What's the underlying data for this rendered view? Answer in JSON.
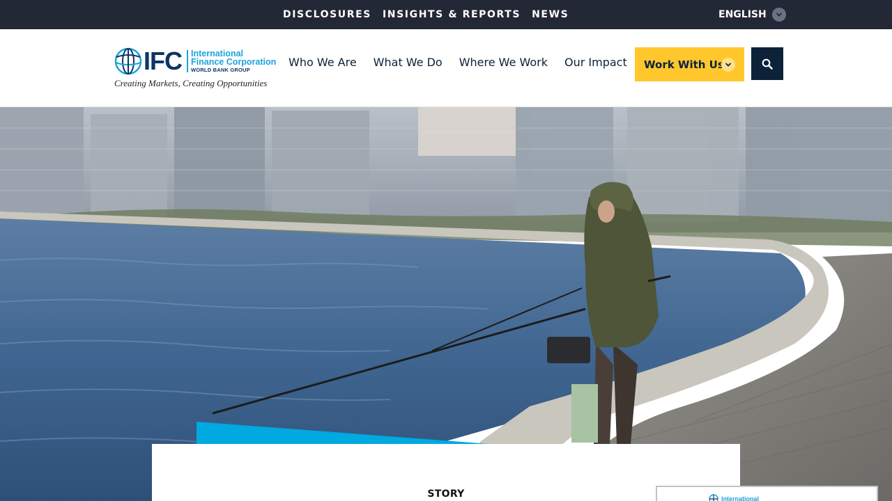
{
  "utility_bar": {
    "links": [
      "DISCLOSURES",
      "INSIGHTS & REPORTS",
      "NEWS"
    ],
    "language": "ENGLISH"
  },
  "logo": {
    "acronym": "IFC",
    "name_line1": "International",
    "name_line2": "Finance Corporation",
    "group": "WORLD BANK GROUP",
    "tagline": "Creating Markets, Creating Opportunities"
  },
  "main_nav": {
    "items": [
      "Who We Are",
      "What We Do",
      "Where We Work",
      "Our Impact"
    ],
    "cta_label": "Work With Us"
  },
  "hero": {
    "story_label": "STORY"
  },
  "mini_panel": {
    "logo_text": "International"
  },
  "colors": {
    "utility_bg": "#232836",
    "navy": "#0b2239",
    "accent_yellow": "#ffc72c",
    "brand_blue": "#1aa3dd",
    "logo_navy": "#0b3563"
  },
  "icons": [
    "chevron-down-icon",
    "search-icon",
    "globe-icon"
  ]
}
